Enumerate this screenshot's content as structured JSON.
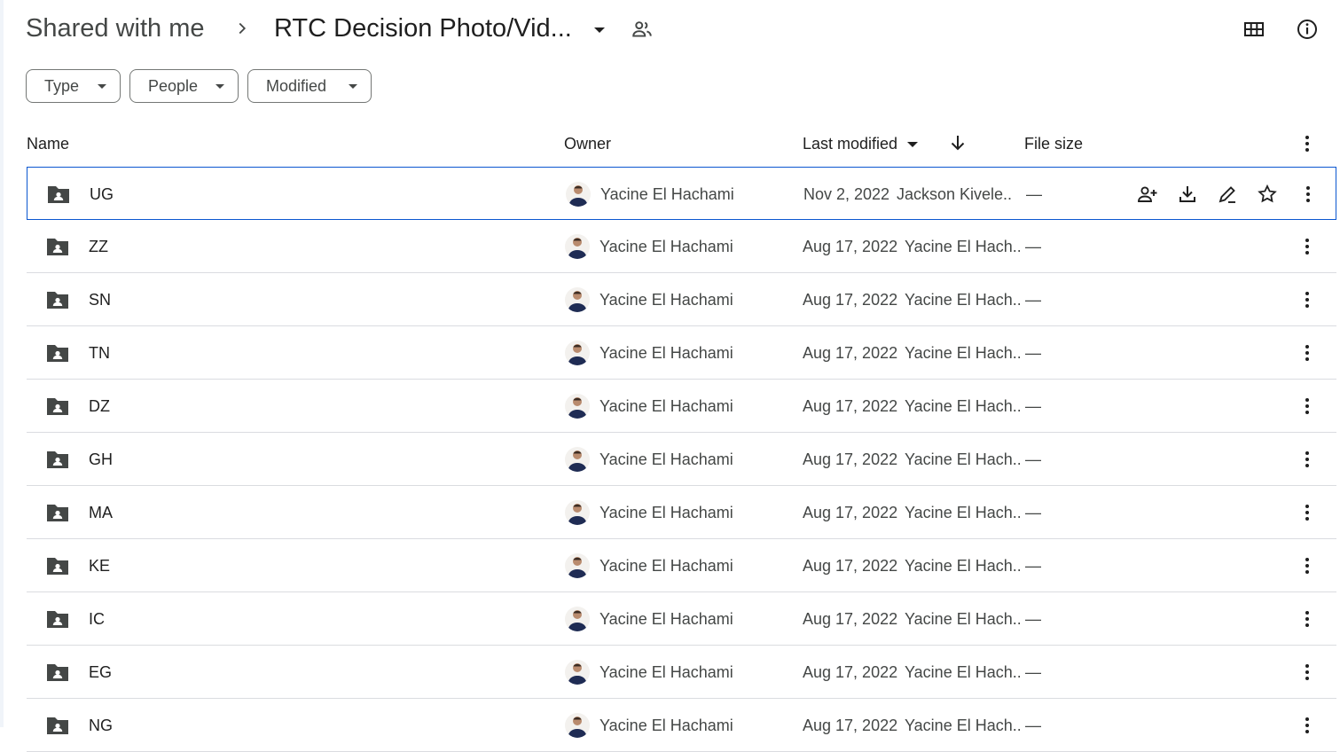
{
  "breadcrumb": {
    "root": "Shared with me",
    "current": "RTC Decision Photo/Vid..."
  },
  "filters": {
    "type": "Type",
    "people": "People",
    "modified": "Modified"
  },
  "columns": {
    "name": "Name",
    "owner": "Owner",
    "last_modified": "Last modified",
    "file_size": "File size"
  },
  "colors": {
    "accent": "#0b57d0",
    "icon": "#444746",
    "divider": "#dadce0"
  },
  "rows": [
    {
      "name": "UG",
      "owner": "Yacine El Hachami",
      "date": "Nov 2, 2022",
      "by": "Jackson Kivele...",
      "size": "—"
    },
    {
      "name": "ZZ",
      "owner": "Yacine El Hachami",
      "date": "Aug 17, 2022",
      "by": "Yacine El Hach...",
      "size": "—"
    },
    {
      "name": "SN",
      "owner": "Yacine El Hachami",
      "date": "Aug 17, 2022",
      "by": "Yacine El Hach...",
      "size": "—"
    },
    {
      "name": "TN",
      "owner": "Yacine El Hachami",
      "date": "Aug 17, 2022",
      "by": "Yacine El Hach...",
      "size": "—"
    },
    {
      "name": "DZ",
      "owner": "Yacine El Hachami",
      "date": "Aug 17, 2022",
      "by": "Yacine El Hach...",
      "size": "—"
    },
    {
      "name": "GH",
      "owner": "Yacine El Hachami",
      "date": "Aug 17, 2022",
      "by": "Yacine El Hach...",
      "size": "—"
    },
    {
      "name": "MA",
      "owner": "Yacine El Hachami",
      "date": "Aug 17, 2022",
      "by": "Yacine El Hach...",
      "size": "—"
    },
    {
      "name": "KE",
      "owner": "Yacine El Hachami",
      "date": "Aug 17, 2022",
      "by": "Yacine El Hach...",
      "size": "—"
    },
    {
      "name": "IC",
      "owner": "Yacine El Hachami",
      "date": "Aug 17, 2022",
      "by": "Yacine El Hach...",
      "size": "—"
    },
    {
      "name": "EG",
      "owner": "Yacine El Hachami",
      "date": "Aug 17, 2022",
      "by": "Yacine El Hach...",
      "size": "—"
    },
    {
      "name": "NG",
      "owner": "Yacine El Hachami",
      "date": "Aug 17, 2022",
      "by": "Yacine El Hach...",
      "size": "—"
    }
  ],
  "selected_row": 0,
  "icons": {
    "row": "shared-folder-icon",
    "hover_actions": [
      "share-icon",
      "download-icon",
      "rename-icon",
      "star-icon"
    ]
  }
}
